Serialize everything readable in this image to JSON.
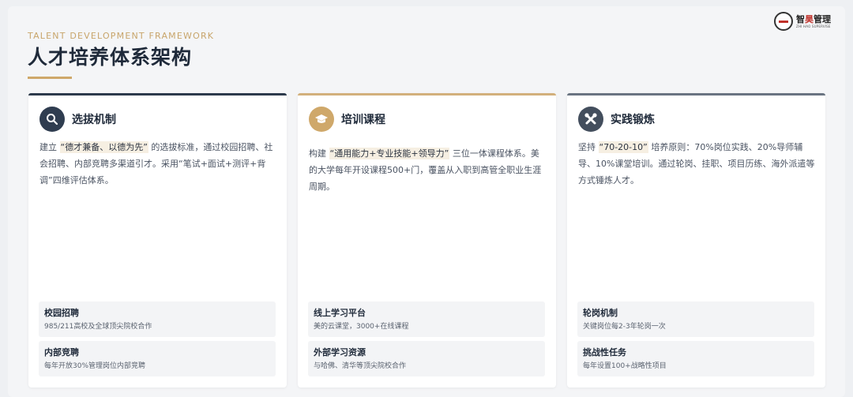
{
  "header": {
    "subtitle": "TALENT DEVELOPMENT FRAMEWORK",
    "title": "人才培养体系架构"
  },
  "logo": {
    "name": "智昊管理",
    "name_part1": "智",
    "name_part2": "昊",
    "name_part3": "管理",
    "sub": "ZHI HAO SUPERVISE"
  },
  "cards": [
    {
      "title": "选拔机制",
      "icon": "search-icon",
      "desc_pre": "建立 ",
      "desc_highlight": "“德才兼备、以德为先”",
      "desc_post": " 的选拔标准，通过校园招聘、社会招聘、内部竞聘多渠道引才。采用“笔试+面试+测评+背调”四维评估体系。",
      "features": [
        {
          "title": "校园招聘",
          "desc": "985/211高校及全球顶尖院校合作"
        },
        {
          "title": "内部竞聘",
          "desc": "每年开放30%管理岗位内部竞聘"
        }
      ]
    },
    {
      "title": "培训课程",
      "icon": "graduation-cap-icon",
      "desc_pre": "构建 ",
      "desc_highlight": "“通用能力+专业技能+领导力”",
      "desc_post": " 三位一体课程体系。美的大学每年开设课程500+门，覆盖从入职到高管全职业生涯周期。",
      "features": [
        {
          "title": "线上学习平台",
          "desc": "美的云课堂，3000+在线课程"
        },
        {
          "title": "外部学习资源",
          "desc": "与哈佛、清华等顶尖院校合作"
        }
      ]
    },
    {
      "title": "实践锻炼",
      "icon": "tools-icon",
      "desc_pre": "坚持 ",
      "desc_highlight": "“70-20-10”",
      "desc_post": " 培养原则：70%岗位实践、20%导师辅导、10%课堂培训。通过轮岗、挂职、项目历练、海外派遣等方式锤炼人才。",
      "features": [
        {
          "title": "轮岗机制",
          "desc": "关键岗位每2-3年轮岗一次"
        },
        {
          "title": "挑战性任务",
          "desc": "每年设置100+战略性项目"
        }
      ]
    }
  ],
  "colors": {
    "accent_gold": "#cfa86a",
    "navy": "#2d3a4c",
    "slate": "#6a7482"
  }
}
